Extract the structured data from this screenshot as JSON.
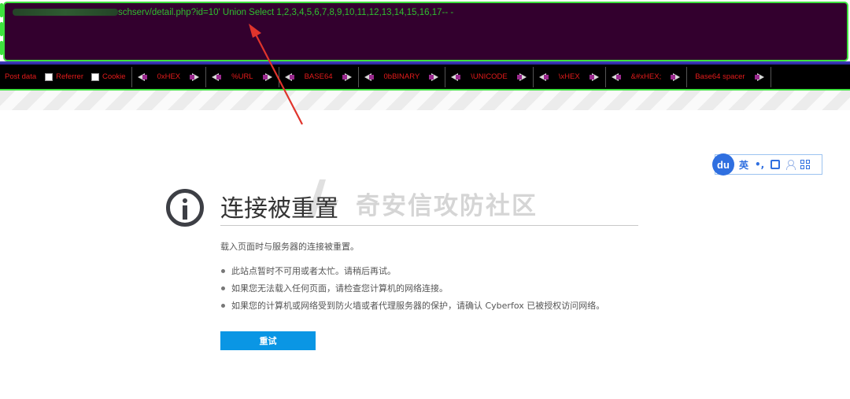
{
  "hackbar": {
    "url_visible": "schserv/detail.php?id=10'  Union Select 1,2,3,4,5,6,7,8,9,10,11,12,13,14,15,16,17-- -",
    "toolbar": {
      "post_data": "Post data",
      "referrer": "Referrer",
      "cookie": "Cookie",
      "encoders": [
        "0xHEX",
        "%URL",
        "BASE64",
        "0bBINARY",
        "\\UNICODE",
        "\\xHEX",
        "&#xHEX;",
        "Base64 spacer"
      ]
    }
  },
  "ime": {
    "logo": "du",
    "lang": "英",
    "punct": "•,"
  },
  "watermark": "奇安信攻防社区",
  "error": {
    "title": "连接被重置",
    "description": "载入页面时与服务器的连接被重置。",
    "bullets": [
      "此站点暂时不可用或者太忙。请稍后再试。",
      "如果您无法载入任何页面，请检查您计算机的网络连接。",
      "如果您的计算机或网络受到防火墙或者代理服务器的保护，请确认 Cyberfox 已被授权访问网络。"
    ],
    "retry": "重试"
  },
  "colors": {
    "hackbar_bg": "#33002e",
    "hackbar_border": "#3ee23e",
    "url_text": "#2fbf2f",
    "toolbar_text": "#e41b1b",
    "retry_button": "#0a96e4",
    "annotation_arrow": "#e0342c"
  }
}
